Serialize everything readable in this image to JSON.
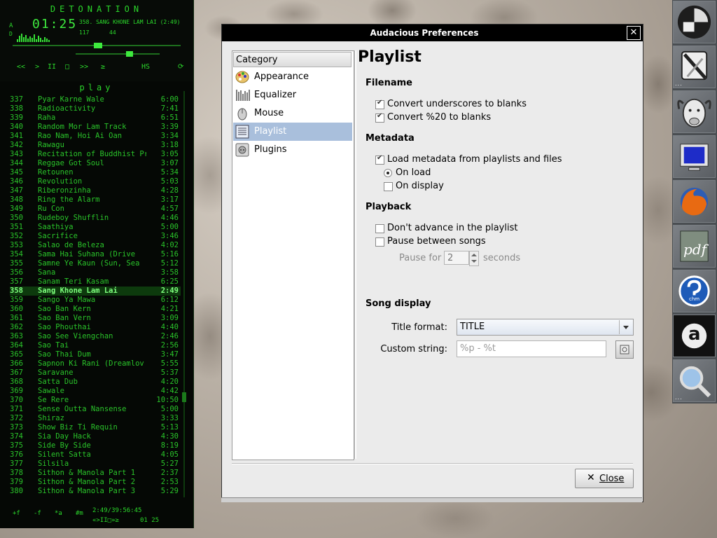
{
  "player": {
    "brand": "DETONATION",
    "indicator_a": "A",
    "indicator_d": "D",
    "time": "01:25",
    "now_playing": "358. SANG KHONE LAM LAI (2:49)",
    "bitrate": "117",
    "khz": "44",
    "controls": [
      "<<",
      ">",
      "II",
      "□",
      ">>",
      "≥",
      "HS",
      "⟳"
    ],
    "playlist_header": "play",
    "tracks": [
      {
        "num": "337",
        "title": "Pyar Karne Wale",
        "dur": "6:00"
      },
      {
        "num": "338",
        "title": "Radioactivity",
        "dur": "7:41"
      },
      {
        "num": "339",
        "title": "Raha",
        "dur": "6:51"
      },
      {
        "num": "340",
        "title": "Random Mor Lam Track",
        "dur": "3:39"
      },
      {
        "num": "341",
        "title": "Rao Nam, Hoi Ai Oan",
        "dur": "3:34"
      },
      {
        "num": "342",
        "title": "Rawagu",
        "dur": "3:18"
      },
      {
        "num": "343",
        "title": "Recitation of Buddhist Pra",
        "dur": "3:05"
      },
      {
        "num": "344",
        "title": "Reggae Got Soul",
        "dur": "3:07"
      },
      {
        "num": "345",
        "title": "Retounen",
        "dur": "5:34"
      },
      {
        "num": "346",
        "title": "Revolution",
        "dur": "5:03"
      },
      {
        "num": "347",
        "title": "Riberonzinha",
        "dur": "4:28"
      },
      {
        "num": "348",
        "title": "Ring the Alarm",
        "dur": "3:17"
      },
      {
        "num": "349",
        "title": "Ru Con",
        "dur": "4:57"
      },
      {
        "num": "350",
        "title": "Rudeboy Shufflin",
        "dur": "4:46"
      },
      {
        "num": "351",
        "title": "Saathiya",
        "dur": "5:00"
      },
      {
        "num": "352",
        "title": "Sacrifice",
        "dur": "3:46"
      },
      {
        "num": "353",
        "title": "Salao de Beleza",
        "dur": "4:02"
      },
      {
        "num": "354",
        "title": "Sama Hai Suhana (Drive",
        "dur": "5:16"
      },
      {
        "num": "355",
        "title": "Samne Ye Kaun (Sun, Sea",
        "dur": "5:12"
      },
      {
        "num": "356",
        "title": "Sana",
        "dur": "3:58"
      },
      {
        "num": "357",
        "title": "Sanam Teri Kasam",
        "dur": "6:25"
      },
      {
        "num": "358",
        "title": "Sang Khone Lam Lai",
        "dur": "2:49"
      },
      {
        "num": "359",
        "title": "Sango Ya Mawa",
        "dur": "6:12"
      },
      {
        "num": "360",
        "title": "Sao Ban Kern",
        "dur": "4:21"
      },
      {
        "num": "361",
        "title": "Sao Ban Vern",
        "dur": "3:09"
      },
      {
        "num": "362",
        "title": "Sao Phouthai",
        "dur": "4:40"
      },
      {
        "num": "363",
        "title": "Sao See Viengchan",
        "dur": "2:46"
      },
      {
        "num": "364",
        "title": "Sao Tai",
        "dur": "2:56"
      },
      {
        "num": "365",
        "title": "Sao Thai Dum",
        "dur": "3:47"
      },
      {
        "num": "366",
        "title": "Sapnon Ki Rani (Dreamlov",
        "dur": "5:55"
      },
      {
        "num": "367",
        "title": "Saravane",
        "dur": "5:37"
      },
      {
        "num": "368",
        "title": "Satta Dub",
        "dur": "4:20"
      },
      {
        "num": "369",
        "title": "Sawale",
        "dur": "4:42"
      },
      {
        "num": "370",
        "title": "Se Rere",
        "dur": "10:50"
      },
      {
        "num": "371",
        "title": "Sense Outta Nansense",
        "dur": "5:00"
      },
      {
        "num": "372",
        "title": "Shiraz",
        "dur": "3:33"
      },
      {
        "num": "373",
        "title": "Show Biz Ti Requin",
        "dur": "5:13"
      },
      {
        "num": "374",
        "title": "Sia Day Hack",
        "dur": "4:30"
      },
      {
        "num": "375",
        "title": "Side By Side",
        "dur": "8:19"
      },
      {
        "num": "376",
        "title": "Silent Satta",
        "dur": "4:05"
      },
      {
        "num": "377",
        "title": "Silsila",
        "dur": "5:27"
      },
      {
        "num": "378",
        "title": "Sithon & Manola Part 1",
        "dur": "2:37"
      },
      {
        "num": "379",
        "title": "Sithon & Manola Part 2",
        "dur": "2:53"
      },
      {
        "num": "380",
        "title": "Sithon & Manola Part 3",
        "dur": "5:29"
      }
    ],
    "selected_track": "358",
    "footer_buttons": [
      "+f",
      "-f",
      "*a",
      "#m"
    ],
    "footer_total": "2:49/39:56:45",
    "footer_time": "01 25",
    "footer_mini": "«>II□»≥"
  },
  "dialog": {
    "title": "Audacious Preferences",
    "close_x": "✕",
    "category_header": "Category",
    "categories": [
      {
        "label": "Appearance",
        "icon": "palette-icon"
      },
      {
        "label": "Equalizer",
        "icon": "equalizer-icon"
      },
      {
        "label": "Mouse",
        "icon": "mouse-icon"
      },
      {
        "label": "Playlist",
        "icon": "playlist-icon",
        "selected": true
      },
      {
        "label": "Plugins",
        "icon": "plugin-icon"
      }
    ],
    "pane_title": "Playlist",
    "filename": {
      "heading": "Filename",
      "convert_underscores": {
        "label": "Convert underscores to blanks",
        "checked": true
      },
      "convert_percent20": {
        "label": "Convert %20 to blanks",
        "checked": true
      }
    },
    "metadata": {
      "heading": "Metadata",
      "load_metadata": {
        "label": "Load metadata from playlists and files",
        "checked": true
      },
      "on_load": {
        "label": "On load",
        "selected": true
      },
      "on_display": {
        "label": "On display",
        "selected": false
      }
    },
    "playback": {
      "heading": "Playback",
      "dont_advance": {
        "label": "Don't advance in the playlist",
        "checked": false
      },
      "pause_between": {
        "label": "Pause between songs",
        "checked": false
      },
      "pause_for_label": "Pause for",
      "pause_for_value": "2",
      "seconds_label": "seconds"
    },
    "song_display": {
      "heading": "Song display",
      "title_format_label": "Title format:",
      "title_format_value": "TITLE",
      "custom_string_label": "Custom string:",
      "custom_string_placeholder": "%p - %t"
    },
    "close_button": {
      "icon": "✕",
      "label": "Close"
    }
  },
  "dock": {
    "items": [
      "window-manager-icon",
      "settings-tools-icon",
      "gnu-icon",
      "monitor-icon",
      "firefox-icon",
      "pdf-icon",
      "chm-icon",
      "a-icon",
      "magnifier-icon"
    ],
    "pdf_text": "pdf",
    "chm_text": "chm",
    "a_text": "a"
  },
  "colors": {
    "player_green": "#22c322",
    "selection_blue": "#a9bfdc",
    "dialog_bg": "#ebebeb"
  }
}
